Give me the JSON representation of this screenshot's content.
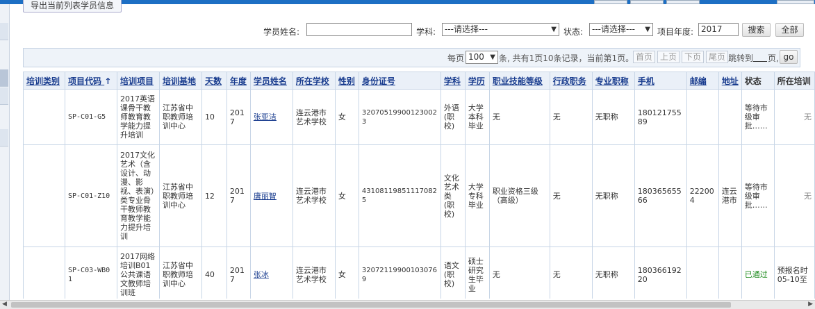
{
  "toolbar": {
    "export_label": "导出当前列表学员信息"
  },
  "search": {
    "name_label": "学员姓名:",
    "name_value": "",
    "subject_label": "学科:",
    "subject_value": "---请选择---",
    "status_label": "状态:",
    "status_value": "---请选择---",
    "year_label": "项目年度:",
    "year_value": "2017",
    "search_label": "搜索",
    "all_label": "全部"
  },
  "pager": {
    "per_page_prefix": "每页",
    "per_page_value": "100",
    "summary": "条, 共有1页10条记录，当前第1页。",
    "first": "首页",
    "prev": "上页",
    "next": "下页",
    "last": "尾页",
    "jump_prefix": "跳转到",
    "jump_suffix": "页,",
    "go": "go"
  },
  "table": {
    "headers": [
      "培训类别",
      "项目代码",
      "培训项目",
      "培训基地",
      "天数",
      "年度",
      "学员姓名",
      "所在学校",
      "性别",
      "身份证号",
      "学科",
      "学历",
      "职业技能等级",
      "行政职务",
      "专业职称",
      "手机",
      "邮编",
      "地址",
      "状态",
      "所在培训"
    ],
    "sort_arrow": "↑",
    "rows": [
      {
        "category": "",
        "code": "SP-C01-G5",
        "project": "2017英语课骨干教师教育教学能力提升培训",
        "base": "江苏省中职教师培训中心",
        "days": "10",
        "year": "2017",
        "name": "张亚洁",
        "school": "连云港市艺术学校",
        "gender": "女",
        "id": "320705199001230023",
        "subject": "外语(职校)",
        "education": "大学本科毕业",
        "skill": "无",
        "admin": "无",
        "title": "无职称",
        "phone": "18012175589",
        "zip": "",
        "address": "",
        "status": "等待市级审批……",
        "training": "无"
      },
      {
        "category": "",
        "code": "SP-C01-Z10",
        "project": "2017文化艺术（含设计、动漫、影视、表演）类专业骨干教师教育教学能力提升培训",
        "base": "江苏省中职教师培训中心",
        "days": "12",
        "year": "2017",
        "name": "唐丽智",
        "school": "连云港市艺术学校",
        "gender": "女",
        "id": "431081198511170825",
        "subject": "文化艺术类(职校)",
        "education": "大学专科毕业",
        "skill": "职业资格三级（高级）",
        "admin": "无",
        "title": "无职称",
        "phone": "18036565566",
        "zip": "222004",
        "address": "连云港市",
        "status": "等待市级审批……",
        "training": "无"
      },
      {
        "category": "",
        "code": "SP-C03-WB01",
        "project": "2017网络培训B01公共课语文教师培训班",
        "base": "江苏省中职教师培训中心",
        "days": "40",
        "year": "2017",
        "name": "张冰",
        "school": "连云港市艺术学校",
        "gender": "女",
        "id": "320721199001030769",
        "subject": "语文(职校)",
        "education": "硕士研究生毕业",
        "skill": "无",
        "admin": "无",
        "title": "无职称",
        "phone": "18036619220",
        "zip": "",
        "address": "",
        "status": "已通过",
        "training": "预报名时 05-10至"
      }
    ]
  }
}
